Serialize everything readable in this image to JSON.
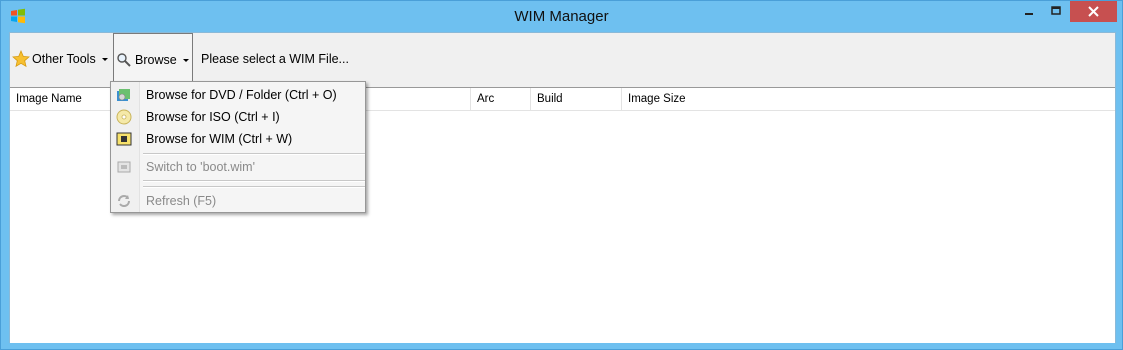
{
  "window": {
    "title": "WIM Manager",
    "icon": "windows-flag-icon",
    "controls": {
      "minimize": "minimize-icon",
      "maximize": "maximize-icon",
      "close": "close-icon"
    }
  },
  "toolbar": {
    "other_tools_label": "Other Tools",
    "browse_label": "Browse",
    "status_text": "Please select a WIM File..."
  },
  "grid": {
    "columns": [
      "Image Name",
      "Arc",
      "Build",
      "Image Size"
    ]
  },
  "browse_menu": {
    "items": [
      {
        "label": "Browse for DVD / Folder (Ctrl + O)",
        "icon": "dvd-folder-icon",
        "enabled": true
      },
      {
        "label": "Browse for ISO (Ctrl + I)",
        "icon": "disc-icon",
        "enabled": true
      },
      {
        "label": "Browse for WIM  (Ctrl + W)",
        "icon": "wim-file-icon",
        "enabled": true
      },
      {
        "label": "Switch to 'boot.wim'",
        "icon": "switch-icon",
        "enabled": false
      },
      {
        "label": "Refresh (F5)",
        "icon": "refresh-icon",
        "enabled": false
      }
    ]
  },
  "colors": {
    "frame": "#6ec0f0",
    "close_button": "#c75050",
    "client_bg": "#f0f0f0"
  }
}
